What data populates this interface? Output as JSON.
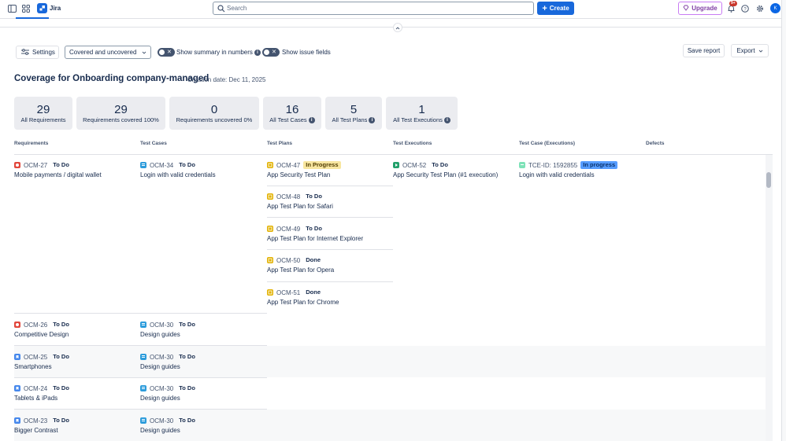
{
  "header": {
    "app_name": "Jira",
    "search_placeholder": "Search",
    "create_label": "Create",
    "upgrade_label": "Upgrade",
    "notification_count": "9+",
    "avatar_initial": "K"
  },
  "controls": {
    "settings_label": "Settings",
    "filter_value": "Covered and uncovered",
    "show_summary_label": "Show summary in numbers",
    "show_issue_fields_label": "Show issue fields",
    "save_report_label": "Save report",
    "export_label": "Export"
  },
  "report": {
    "title": "Coverage for Onboarding company-managed",
    "creation_date": "Creation date: Dec 11, 2025"
  },
  "stats": [
    {
      "value": "29",
      "label": "All Requirements"
    },
    {
      "value": "29",
      "label": "Requirements covered 100%"
    },
    {
      "value": "0",
      "label": "Requirements uncovered 0%"
    },
    {
      "value": "16",
      "label": "All Test Cases"
    },
    {
      "value": "5",
      "label": "All Test Plans"
    },
    {
      "value": "1",
      "label": "All Test Executions"
    }
  ],
  "columns": [
    "Requirements",
    "Test Cases",
    "Test Plans",
    "Test Executions",
    "Test Case (Executions)",
    "Defects"
  ],
  "rows": [
    {
      "requirement": {
        "type": "bug",
        "key": "OCM-27",
        "status": "To Do",
        "summary": "Mobile payments / digital wallet"
      },
      "test_case": {
        "key": "OCM-34",
        "status": "To Do",
        "summary": "Login with valid credentials"
      },
      "test_plans": [
        {
          "key": "OCM-47",
          "status": "In Progress",
          "summary": "App Security Test Plan"
        },
        {
          "key": "OCM-48",
          "status": "To Do",
          "summary": "App Test Plan for Safari"
        },
        {
          "key": "OCM-49",
          "status": "To Do",
          "summary": "App Test Plan for Internet Explorer"
        },
        {
          "key": "OCM-50",
          "status": "Done",
          "summary": "App Test Plan for Opera"
        },
        {
          "key": "OCM-51",
          "status": "Done",
          "summary": "App Test Plan for Chrome"
        }
      ],
      "test_execution": {
        "key": "OCM-52",
        "status": "To Do",
        "summary": "App Security Test Plan (#1 execution)"
      },
      "test_case_execution": {
        "key": "TCE-ID: 1592855",
        "status": "In progress",
        "summary": "Login with valid credentials"
      }
    },
    {
      "requirement": {
        "type": "bug",
        "key": "OCM-26",
        "status": "To Do",
        "summary": "Competitive Design"
      },
      "test_case": {
        "key": "OCM-30",
        "status": "To Do",
        "summary": "Design guides"
      }
    },
    {
      "requirement": {
        "type": "story",
        "key": "OCM-25",
        "status": "To Do",
        "summary": "Smartphones"
      },
      "test_case": {
        "key": "OCM-30",
        "status": "To Do",
        "summary": "Design guides"
      }
    },
    {
      "requirement": {
        "type": "story",
        "key": "OCM-24",
        "status": "To Do",
        "summary": "Tablets & iPads"
      },
      "test_case": {
        "key": "OCM-30",
        "status": "To Do",
        "summary": "Design guides"
      }
    },
    {
      "requirement": {
        "type": "story",
        "key": "OCM-23",
        "status": "To Do",
        "summary": "Bigger Contrast"
      },
      "test_case": {
        "key": "OCM-30",
        "status": "To Do",
        "summary": "Design guides"
      }
    }
  ]
}
